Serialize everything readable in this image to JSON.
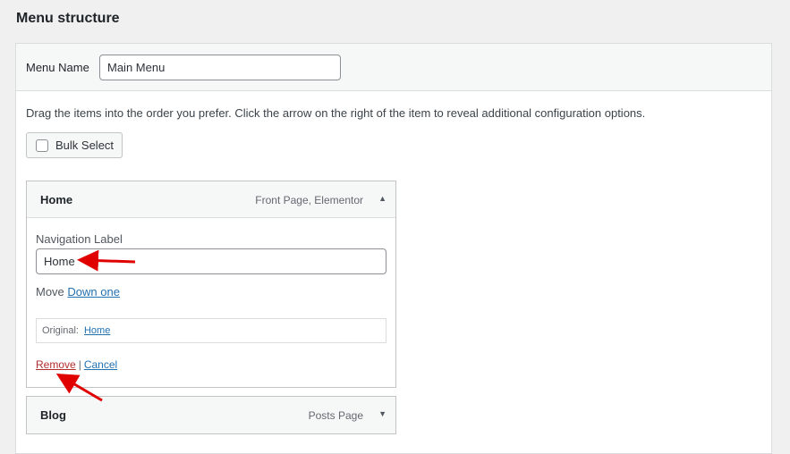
{
  "page": {
    "title": "Menu structure"
  },
  "menu": {
    "name_label": "Menu Name",
    "name_value": "Main Menu",
    "instructions": "Drag the items into the order you prefer. Click the arrow on the right of the item to reveal additional configuration options.",
    "bulk_select_label": "Bulk Select"
  },
  "items": [
    {
      "title": "Home",
      "type": "Front Page, Elementor",
      "expanded": true,
      "nav_label_caption": "Navigation Label",
      "nav_label_value": "Home",
      "move_label": "Move",
      "move_link": "Down one",
      "original_label": "Original:",
      "original_link": "Home",
      "remove_label": "Remove",
      "separator": "|",
      "cancel_label": "Cancel",
      "toggle_icon": "triangle-up"
    },
    {
      "title": "Blog",
      "type": "Posts Page",
      "expanded": false,
      "toggle_icon": "triangle-down"
    }
  ],
  "annotations": {
    "arrow_color": "#e00000"
  }
}
